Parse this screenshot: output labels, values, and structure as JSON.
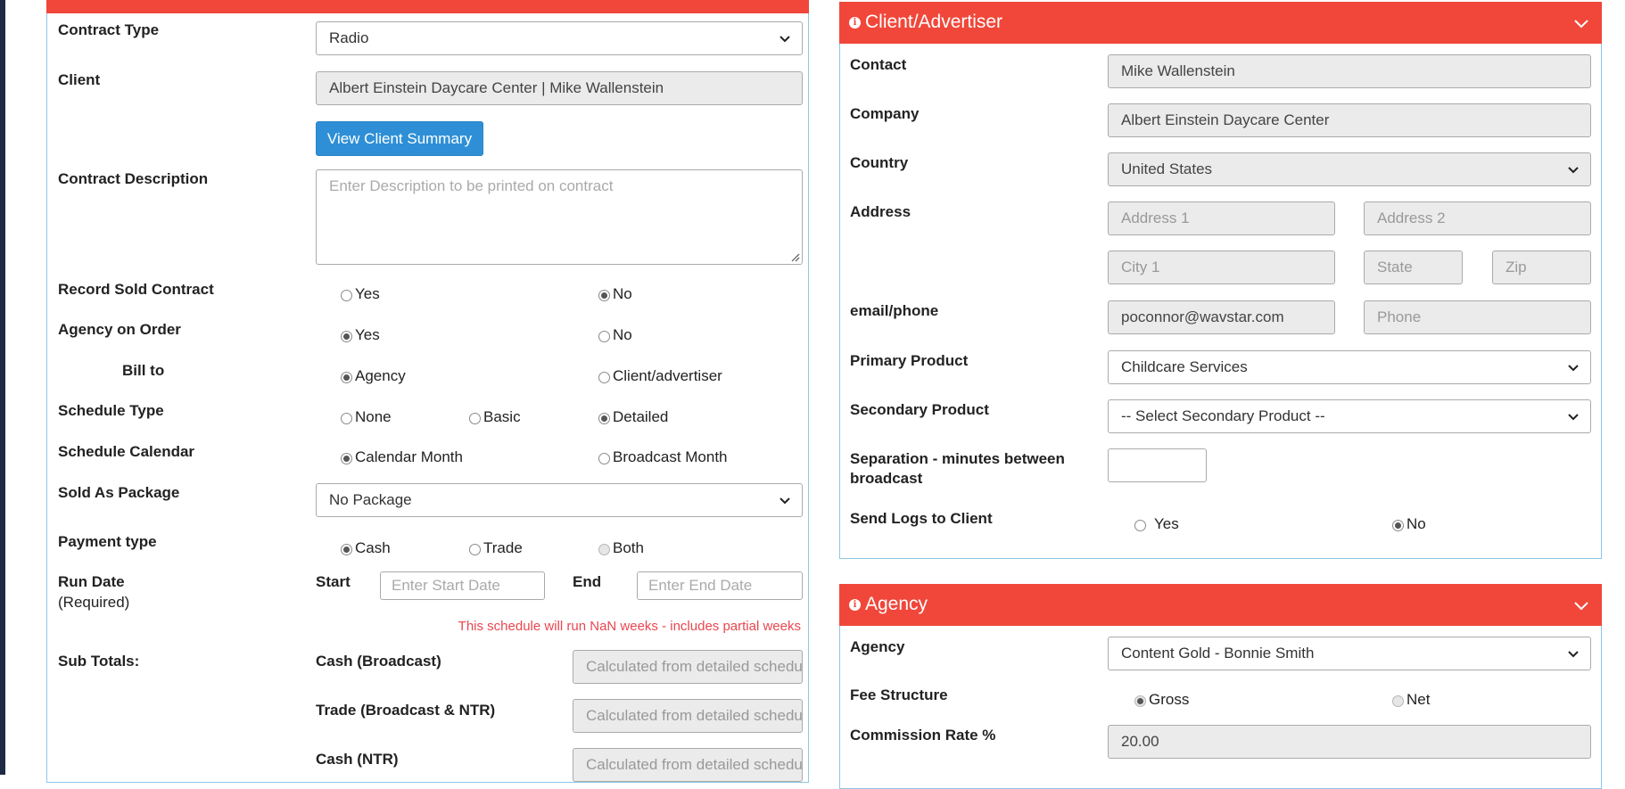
{
  "contract": {
    "contract_type_label": "Contract Type",
    "contract_type_value": "Radio",
    "client_label": "Client",
    "client_value": "Albert Einstein Daycare Center | Mike Wallenstein",
    "view_client_summary": "View Client Summary",
    "description_label": "Contract Description",
    "description_placeholder": "Enter Description to be printed on contract",
    "record_sold_label": "Record Sold Contract",
    "record_sold_options": [
      "Yes",
      "No"
    ],
    "record_sold_selected": "No",
    "agency_on_order_label": "Agency on Order",
    "agency_on_order_options": [
      "Yes",
      "No"
    ],
    "agency_on_order_selected": "Yes",
    "bill_to_label": "Bill to",
    "bill_to_options": [
      "Agency",
      "Client/advertiser"
    ],
    "bill_to_selected": "Agency",
    "schedule_type_label": "Schedule Type",
    "schedule_type_options": [
      "None",
      "Basic",
      "Detailed"
    ],
    "schedule_type_selected": "Detailed",
    "schedule_calendar_label": "Schedule Calendar",
    "schedule_calendar_options": [
      "Calendar Month",
      "Broadcast Month"
    ],
    "schedule_calendar_selected": "Calendar Month",
    "sold_as_package_label": "Sold As Package",
    "sold_as_package_value": "No Package",
    "payment_type_label": "Payment type",
    "payment_type_options": [
      "Cash",
      "Trade",
      "Both"
    ],
    "payment_type_selected": "Cash",
    "run_date_label": "Run Date",
    "run_date_required": "(Required)",
    "start_label": "Start",
    "start_placeholder": "Enter Start Date",
    "end_label": "End",
    "end_placeholder": "Enter End Date",
    "schedule_warning": "This schedule will run NaN weeks - includes partial weeks",
    "subtotals_label": "Sub Totals:",
    "subtotals": [
      {
        "label": "Cash (Broadcast)",
        "placeholder": "Calculated from detailed schedule"
      },
      {
        "label": "Trade (Broadcast & NTR)",
        "placeholder": "Calculated from detailed schedule"
      },
      {
        "label": "Cash (NTR)",
        "placeholder": "Calculated from detailed schedule"
      }
    ]
  },
  "client": {
    "title": "Client/Advertiser",
    "contact_label": "Contact",
    "contact_value": "Mike Wallenstein",
    "company_label": "Company",
    "company_value": "Albert Einstein Daycare Center",
    "country_label": "Country",
    "country_value": "United States",
    "address_label": "Address",
    "address1_placeholder": "Address 1",
    "address2_placeholder": "Address 2",
    "city_placeholder": "City 1",
    "state_placeholder": "State",
    "zip_placeholder": "Zip",
    "email_phone_label": "email/phone",
    "email_value": "poconnor@wavstar.com",
    "phone_placeholder": "Phone",
    "primary_product_label": "Primary Product",
    "primary_product_value": "Childcare Services",
    "secondary_product_label": "Secondary Product",
    "secondary_product_value": "-- Select Secondary Product --",
    "separation_label_line1": "Separation - minutes between",
    "separation_label_line2": "broadcast",
    "separation_value": "",
    "send_logs_label": "Send Logs to Client",
    "send_logs_options": [
      "Yes",
      "No"
    ],
    "send_logs_selected": "No"
  },
  "agency": {
    "title": "Agency",
    "agency_label": "Agency",
    "agency_value": "Content Gold - Bonnie Smith",
    "fee_structure_label": "Fee Structure",
    "fee_structure_options": [
      "Gross",
      "Net"
    ],
    "fee_structure_selected": "Gross",
    "commission_label": "Commission Rate %",
    "commission_value": "20.00"
  },
  "icons": {
    "info": "info-circle-icon",
    "collapse": "chevron-down-icon"
  },
  "colors": {
    "header_red": "#f0473a",
    "button_blue": "#2e8fd6",
    "panel_border": "#8fc6e6",
    "warning_red": "#e8464f"
  }
}
